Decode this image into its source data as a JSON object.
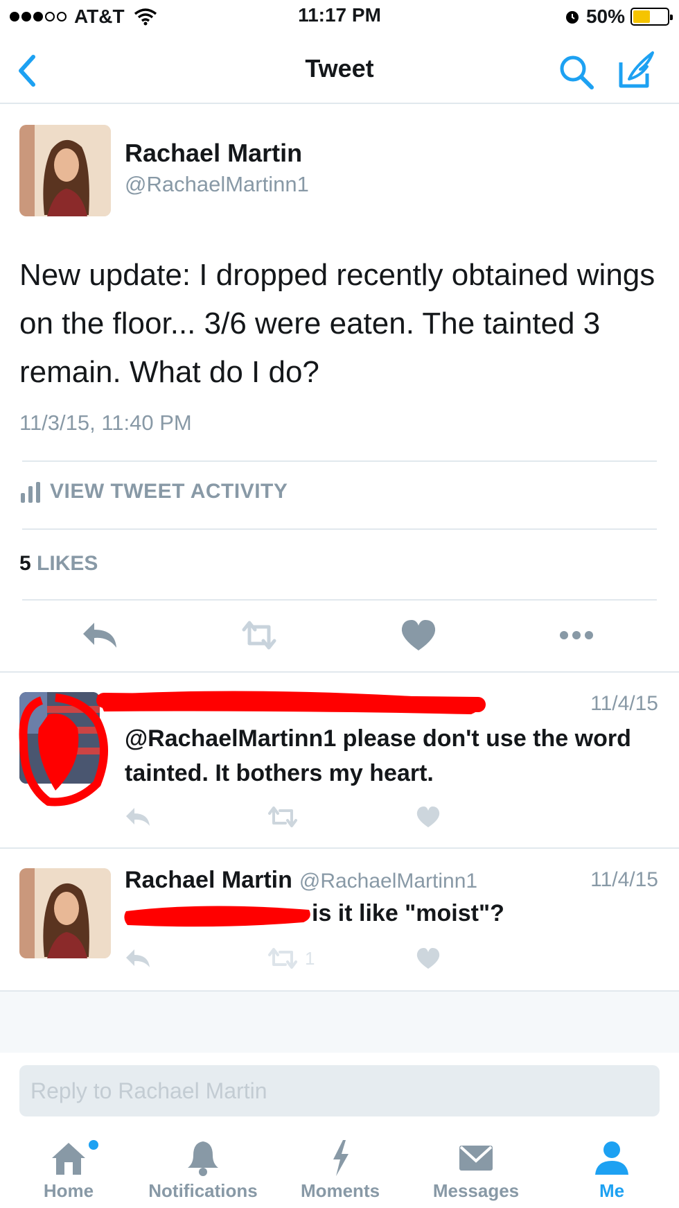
{
  "status_bar": {
    "carrier": "AT&T",
    "time": "11:17 PM",
    "battery_percent": "50%",
    "battery_level": 0.5,
    "signal_dots_filled": 3,
    "signal_dots_total": 5
  },
  "nav": {
    "title": "Tweet",
    "back_icon": "chevron-left-icon",
    "search_icon": "search-icon",
    "compose_icon": "compose-icon"
  },
  "main_tweet": {
    "name": "Rachael Martin",
    "handle": "@RachaelMartinn1",
    "text": "New update: I dropped recently obtained wings on the floor... 3/6 were eaten. The tainted 3 remain. What do I do?",
    "timestamp": "11/3/15, 11:40 PM",
    "activity_label": "VIEW TWEET ACTIVITY",
    "likes_count": "5",
    "likes_label": "LIKES"
  },
  "replies": [
    {
      "date": "11/4/15",
      "text": "@RachaelMartinn1 please don't use the word tainted. It bothers my heart.",
      "retweet_count": "",
      "redacted": true
    },
    {
      "name": "Rachael Martin",
      "handle": "@RachaelMartinn1",
      "date": "11/4/15",
      "text": "is it like \"moist\"?",
      "retweet_count": "1"
    }
  ],
  "reply_box": {
    "placeholder": "Reply to Rachael Martin"
  },
  "tabs": [
    {
      "label": "Home",
      "icon": "home-icon",
      "active": false
    },
    {
      "label": "Notifications",
      "icon": "bell-icon",
      "active": false
    },
    {
      "label": "Moments",
      "icon": "lightning-icon",
      "active": false
    },
    {
      "label": "Messages",
      "icon": "envelope-icon",
      "active": false
    },
    {
      "label": "Me",
      "icon": "person-icon",
      "active": true
    }
  ],
  "colors": {
    "accent": "#1da1f2",
    "muted": "#8899a6",
    "redaction": "#ff0000",
    "battery": "#f5c400"
  }
}
